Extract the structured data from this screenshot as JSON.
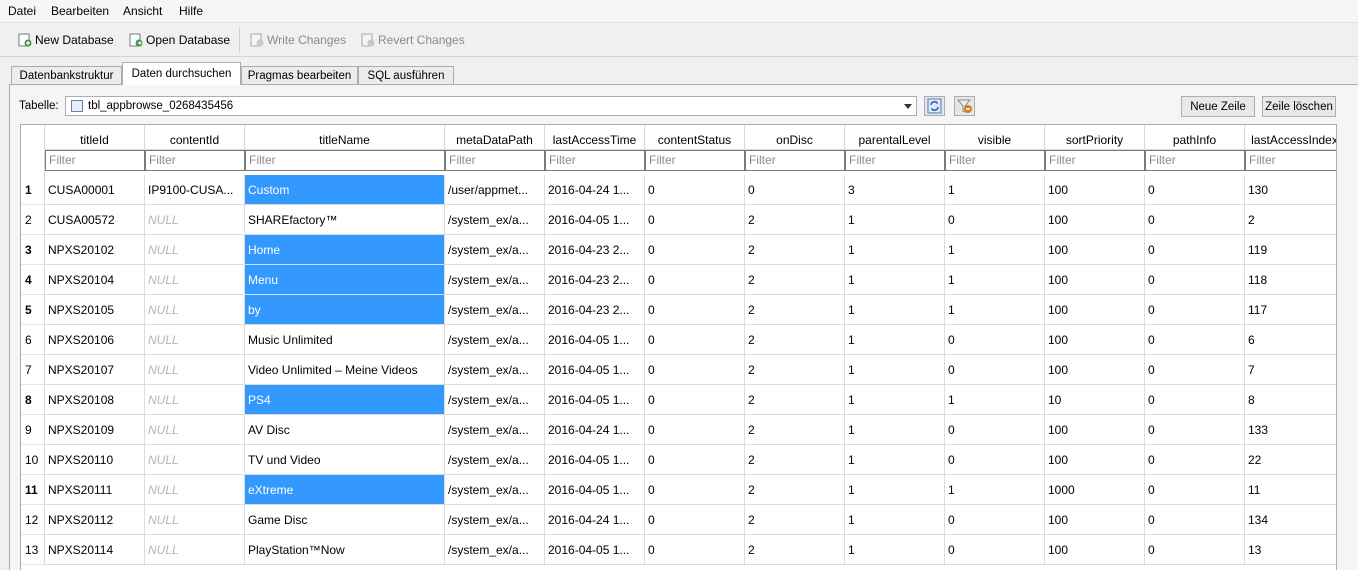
{
  "menu": [
    "Datei",
    "Bearbeiten",
    "Ansicht",
    "Hilfe"
  ],
  "toolbar": {
    "new_db": "New Database",
    "open_db": "Open Database",
    "write": "Write Changes",
    "revert": "Revert Changes"
  },
  "tabs": [
    "Datenbankstruktur",
    "Daten durchsuchen",
    "Pragmas bearbeiten",
    "SQL ausführen"
  ],
  "active_tab": "Daten durchsuchen",
  "table_label": "Tabelle:",
  "table_name": "tbl_appbrowse_0268435456",
  "buttons": {
    "new_row": "Neue Zeile",
    "delete_row": "Zeile löschen"
  },
  "filter_placeholder": "Filter",
  "columns": [
    "titleId",
    "contentId",
    "titleName",
    "metaDataPath",
    "lastAccessTime",
    "contentStatus",
    "onDisc",
    "parentalLevel",
    "visible",
    "sortPriority",
    "pathInfo",
    "lastAccessIndex"
  ],
  "rows": [
    {
      "n": "1",
      "sel": true,
      "cells": [
        "CUSA00001",
        "IP9100-CUSA...",
        "Custom",
        "/user/appmet...",
        "2016-04-24 1...",
        "0",
        "0",
        "3",
        "1",
        "100",
        "0",
        "130"
      ]
    },
    {
      "n": "2",
      "sel": false,
      "cells": [
        "CUSA00572",
        "NULL",
        "SHAREfactory™",
        "/system_ex/a...",
        "2016-04-05 1...",
        "0",
        "2",
        "1",
        "0",
        "100",
        "0",
        "2"
      ]
    },
    {
      "n": "3",
      "sel": true,
      "cells": [
        "NPXS20102",
        "NULL",
        "Home",
        "/system_ex/a...",
        "2016-04-23 2...",
        "0",
        "2",
        "1",
        "1",
        "100",
        "0",
        "119"
      ]
    },
    {
      "n": "4",
      "sel": true,
      "cells": [
        "NPXS20104",
        "NULL",
        "Menu",
        "/system_ex/a...",
        "2016-04-23 2...",
        "0",
        "2",
        "1",
        "1",
        "100",
        "0",
        "118"
      ]
    },
    {
      "n": "5",
      "sel": true,
      "cells": [
        "NPXS20105",
        "NULL",
        "by",
        "/system_ex/a...",
        "2016-04-23 2...",
        "0",
        "2",
        "1",
        "1",
        "100",
        "0",
        "117"
      ]
    },
    {
      "n": "6",
      "sel": false,
      "cells": [
        "NPXS20106",
        "NULL",
        "Music Unlimited",
        "/system_ex/a...",
        "2016-04-05 1...",
        "0",
        "2",
        "1",
        "0",
        "100",
        "0",
        "6"
      ]
    },
    {
      "n": "7",
      "sel": false,
      "cells": [
        "NPXS20107",
        "NULL",
        "Video Unlimited – Meine Videos",
        "/system_ex/a...",
        "2016-04-05 1...",
        "0",
        "2",
        "1",
        "0",
        "100",
        "0",
        "7"
      ]
    },
    {
      "n": "8",
      "sel": true,
      "cells": [
        "NPXS20108",
        "NULL",
        "PS4",
        "/system_ex/a...",
        "2016-04-05 1...",
        "0",
        "2",
        "1",
        "1",
        "10",
        "0",
        "8"
      ]
    },
    {
      "n": "9",
      "sel": false,
      "cells": [
        "NPXS20109",
        "NULL",
        "AV Disc",
        "/system_ex/a...",
        "2016-04-24 1...",
        "0",
        "2",
        "1",
        "0",
        "100",
        "0",
        "133"
      ]
    },
    {
      "n": "10",
      "sel": false,
      "cells": [
        "NPXS20110",
        "NULL",
        "TV und Video",
        "/system_ex/a...",
        "2016-04-05 1...",
        "0",
        "2",
        "1",
        "0",
        "100",
        "0",
        "22"
      ]
    },
    {
      "n": "11",
      "sel": true,
      "cells": [
        "NPXS20111",
        "NULL",
        "eXtreme",
        "/system_ex/a...",
        "2016-04-05 1...",
        "0",
        "2",
        "1",
        "1",
        "1000",
        "0",
        "11"
      ]
    },
    {
      "n": "12",
      "sel": false,
      "cells": [
        "NPXS20112",
        "NULL",
        "Game Disc",
        "/system_ex/a...",
        "2016-04-24 1...",
        "0",
        "2",
        "1",
        "0",
        "100",
        "0",
        "134"
      ]
    },
    {
      "n": "13",
      "sel": false,
      "cells": [
        "NPXS20114",
        "NULL",
        "PlayStation™Now",
        "/system_ex/a...",
        "2016-04-05 1...",
        "0",
        "2",
        "1",
        "0",
        "100",
        "0",
        "13"
      ]
    }
  ],
  "colors": {
    "selection": "#3399ff",
    "null_text": "#b5b5b5"
  }
}
